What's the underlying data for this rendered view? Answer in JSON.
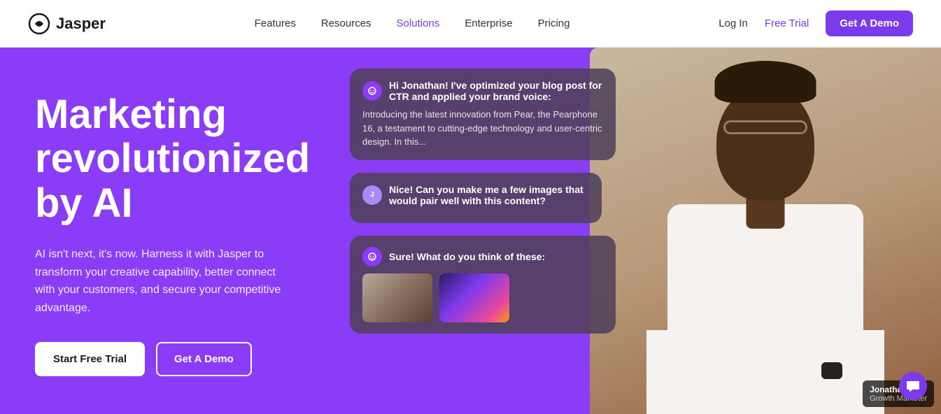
{
  "nav": {
    "logo_text": "Jasper",
    "links": [
      {
        "label": "Features",
        "active": false
      },
      {
        "label": "Resources",
        "active": false
      },
      {
        "label": "Solutions",
        "active": true
      },
      {
        "label": "Enterprise",
        "active": false
      },
      {
        "label": "Pricing",
        "active": false
      }
    ],
    "login_label": "Log In",
    "free_trial_label": "Free Trial",
    "demo_button_label": "Get A Demo"
  },
  "hero": {
    "title": "Marketing revolutionized by AI",
    "subtitle": "AI isn't next, it's now. Harness it with Jasper to transform your creative capability, better connect with your customers, and secure your competitive advantage.",
    "cta_primary": "Start Free Trial",
    "cta_secondary": "Get A Demo",
    "chat": {
      "bubble1": {
        "text": "Hi Jonathan! I've optimized your blog post for CTR and applied your brand voice:",
        "body": "Introducing the latest innovation from Pear, the Pearphone 16, a testament to cutting-edge technology and user-centric design. In this..."
      },
      "bubble2": {
        "text": "Nice! Can you make me a few images that would pair well with this content?"
      },
      "bubble3": {
        "text": "Sure! What do you think of these:"
      }
    },
    "person": {
      "name": "Jonathan",
      "title": "Growth Marketer"
    }
  },
  "colors": {
    "brand_purple": "#7c3aed",
    "hero_purple": "#8b3cf7",
    "nav_bg": "#ffffff"
  }
}
